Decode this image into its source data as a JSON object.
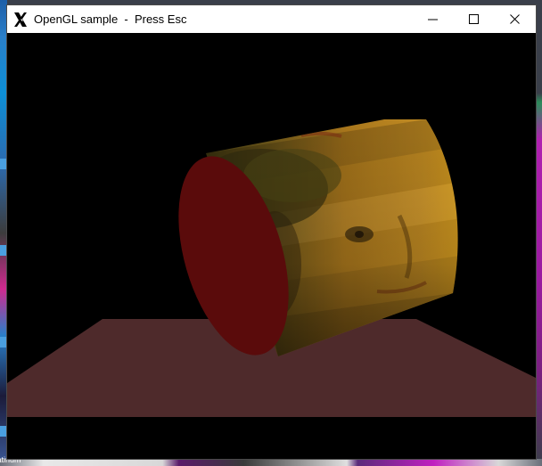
{
  "window": {
    "title": "OpenGL sample  -  Press Esc",
    "icon": "x-window-system-icon",
    "controls": [
      "minimize-icon",
      "maximize-icon",
      "close-icon"
    ]
  },
  "scene": {
    "objects": [
      "textured-cylinder",
      "floor-plane"
    ],
    "colors": {
      "background": "#000000",
      "floor": "#4e2a2b",
      "cylinder_end_cap": "#5a0b0b",
      "texture_base": "#b07c1a",
      "texture_dark": "#4a3e14"
    }
  },
  "desktop": {
    "visible_text": [
      "tatinum"
    ]
  }
}
